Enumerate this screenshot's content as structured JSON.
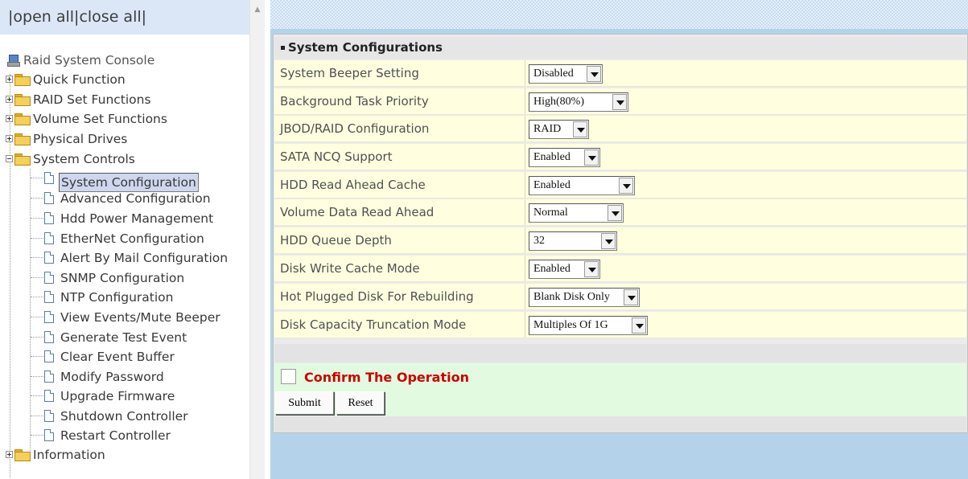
{
  "tree_header": {
    "text": "|open all|close all|"
  },
  "tree": {
    "root": "Raid System Console",
    "folders": {
      "quick_function": "Quick Function",
      "raid_set_functions": "RAID Set Functions",
      "volume_set_functions": "Volume Set Functions",
      "physical_drives": "Physical Drives",
      "system_controls": "System Controls",
      "information": "Information"
    },
    "system_controls_items": [
      {
        "label": "System Configuration",
        "selected": true
      },
      {
        "label": "Advanced Configuration"
      },
      {
        "label": "Hdd Power Management"
      },
      {
        "label": "EtherNet Configuration"
      },
      {
        "label": "Alert By Mail Configuration"
      },
      {
        "label": "SNMP Configuration"
      },
      {
        "label": "NTP Configuration"
      },
      {
        "label": "View Events/Mute Beeper"
      },
      {
        "label": "Generate Test Event"
      },
      {
        "label": "Clear Event Buffer"
      },
      {
        "label": "Modify Password"
      },
      {
        "label": "Upgrade Firmware"
      },
      {
        "label": "Shutdown Controller"
      },
      {
        "label": "Restart Controller"
      }
    ]
  },
  "form": {
    "title": "System Configurations",
    "rows": [
      {
        "label": "System Beeper Setting",
        "value": "Disabled"
      },
      {
        "label": "Background Task Priority",
        "value": "High(80%)"
      },
      {
        "label": "JBOD/RAID Configuration",
        "value": "RAID"
      },
      {
        "label": "SATA NCQ Support",
        "value": "Enabled"
      },
      {
        "label": "HDD Read Ahead Cache",
        "value": "Enabled"
      },
      {
        "label": "Volume Data Read Ahead",
        "value": "Normal"
      },
      {
        "label": "HDD Queue Depth",
        "value": "32"
      },
      {
        "label": "Disk Write Cache Mode",
        "value": "Enabled"
      },
      {
        "label": "Hot Plugged Disk For Rebuilding",
        "value": "Blank Disk Only"
      },
      {
        "label": "Disk Capacity Truncation Mode",
        "value": "Multiples Of 1G"
      }
    ],
    "confirm_label": "Confirm The Operation",
    "confirm_checked": false,
    "submit_label": "Submit",
    "reset_label": "Reset"
  },
  "colors": {
    "form_row_bg": "#ffffe0",
    "confirm_bg": "#e2fbe0",
    "confirm_text": "#cc0000",
    "frame_bg": "#b4d3ea",
    "tree_header_bg": "#dbe7f7",
    "selected_item_bg": "#cfd7ef"
  },
  "icons": {
    "root": "raid-console-icon",
    "folder": "folder-icon",
    "page": "page-icon",
    "expand": "plus-box-icon",
    "collapse": "minus-box-icon",
    "dropdown": "chevron-down-icon"
  }
}
